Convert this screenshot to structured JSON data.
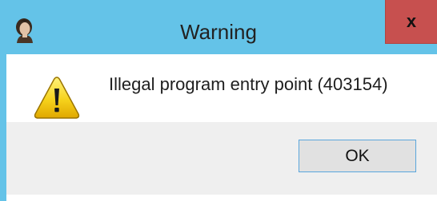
{
  "window": {
    "title": "Warning",
    "close_label": "x",
    "app_icon": "portrait-icon"
  },
  "dialog": {
    "icon": "warning-icon",
    "message": "Illegal program entry point (403154)",
    "ok_label": "OK"
  },
  "colors": {
    "titlebar": "#64c3e8",
    "close_button": "#c7504f",
    "button_area": "#efefef",
    "ok_border": "#5aa6dc"
  }
}
